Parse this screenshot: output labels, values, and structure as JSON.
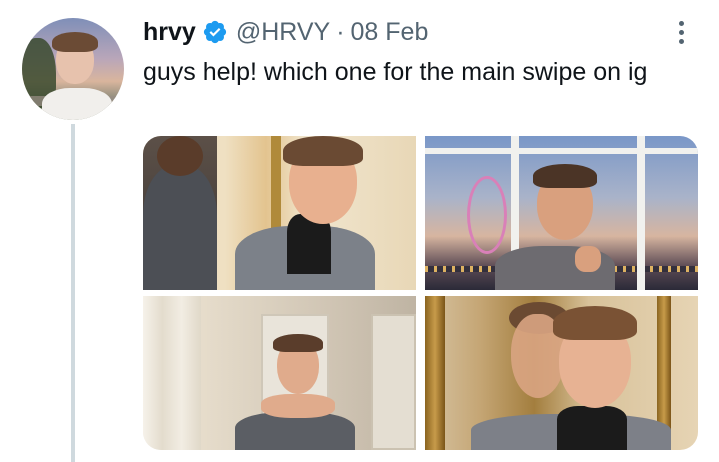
{
  "author": {
    "display_name": "hrvy",
    "handle": "@HRVY",
    "separator": "·",
    "date": "08 Feb",
    "verified": true,
    "verified_icon": "verified-badge-icon",
    "avatar_icon": "profile-avatar"
  },
  "tweet": {
    "text": "guys help! which one for the main swipe on ig"
  },
  "menu": {
    "icon": "more-vertical-icon"
  },
  "media": {
    "count": 4,
    "photos": [
      {
        "icon": "photo-1-mirror-hallway"
      },
      {
        "icon": "photo-2-window-london-eye"
      },
      {
        "icon": "photo-3-doors"
      },
      {
        "icon": "photo-4-gold-mirror"
      }
    ]
  },
  "colors": {
    "text_primary": "#0f1419",
    "text_secondary": "#536471",
    "verified_blue": "#1d9bf0",
    "thread_line": "#cfd9de"
  }
}
